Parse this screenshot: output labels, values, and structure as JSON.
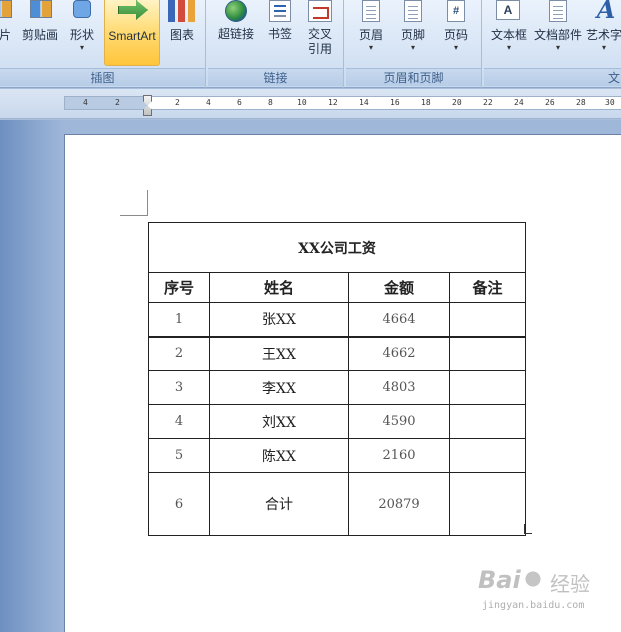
{
  "ribbon": {
    "groups": [
      {
        "caption": "插图",
        "buttons": [
          {
            "label": "片",
            "icon": "picture-icon"
          },
          {
            "label": "剪贴画",
            "icon": "clipart-icon"
          },
          {
            "label": "形状",
            "icon": "shapes-icon",
            "dropdown": "▾"
          },
          {
            "label": "SmartArt",
            "icon": "smartart-icon"
          },
          {
            "label": "图表",
            "icon": "chart-icon"
          }
        ]
      },
      {
        "caption": "链接",
        "buttons": [
          {
            "label": "超链接",
            "icon": "hyperlink-icon"
          },
          {
            "label": "书签",
            "icon": "bookmark-icon"
          },
          {
            "label": "交叉",
            "label2": "引用",
            "icon": "cross-reference-icon"
          }
        ]
      },
      {
        "caption": "页眉和页脚",
        "buttons": [
          {
            "label": "页眉",
            "icon": "header-icon",
            "dropdown": "▾"
          },
          {
            "label": "页脚",
            "icon": "footer-icon",
            "dropdown": "▾"
          },
          {
            "label": "页码",
            "icon": "page-number-icon",
            "dropdown": "▾"
          }
        ]
      },
      {
        "caption": "文",
        "buttons": [
          {
            "label": "文本框",
            "icon": "textbox-icon",
            "dropdown": "▾"
          },
          {
            "label": "文档部件",
            "icon": "quick-parts-icon",
            "dropdown": "▾"
          },
          {
            "label": "艺术字",
            "icon": "wordart-icon",
            "dropdown": "▾"
          }
        ]
      }
    ],
    "page_number_glyph": "#",
    "textbox_glyph": "A",
    "wordart_glyph": "A"
  },
  "ruler": {
    "ticks": [
      "4",
      "2",
      "2",
      "4",
      "6",
      "8",
      "10",
      "12",
      "14",
      "16",
      "18",
      "20",
      "22",
      "24",
      "26",
      "28",
      "30"
    ]
  },
  "table": {
    "title": "XX公司工资",
    "headers": [
      "序号",
      "姓名",
      "金额",
      "备注"
    ],
    "rows": [
      {
        "no": "1",
        "name": "张XX",
        "amount": "4664",
        "note": ""
      },
      {
        "no": "2",
        "name": "王XX",
        "amount": "4662",
        "note": ""
      },
      {
        "no": "3",
        "name": "李XX",
        "amount": "4803",
        "note": ""
      },
      {
        "no": "4",
        "name": "刘XX",
        "amount": "4590",
        "note": ""
      },
      {
        "no": "5",
        "name": "陈XX",
        "amount": "2160",
        "note": ""
      }
    ],
    "total": {
      "no": "6",
      "name": "合计",
      "amount": "20879",
      "note": ""
    }
  },
  "watermark": {
    "logo": "Bai",
    "logo2": "经验",
    "url": "jingyan.baidu.com"
  }
}
